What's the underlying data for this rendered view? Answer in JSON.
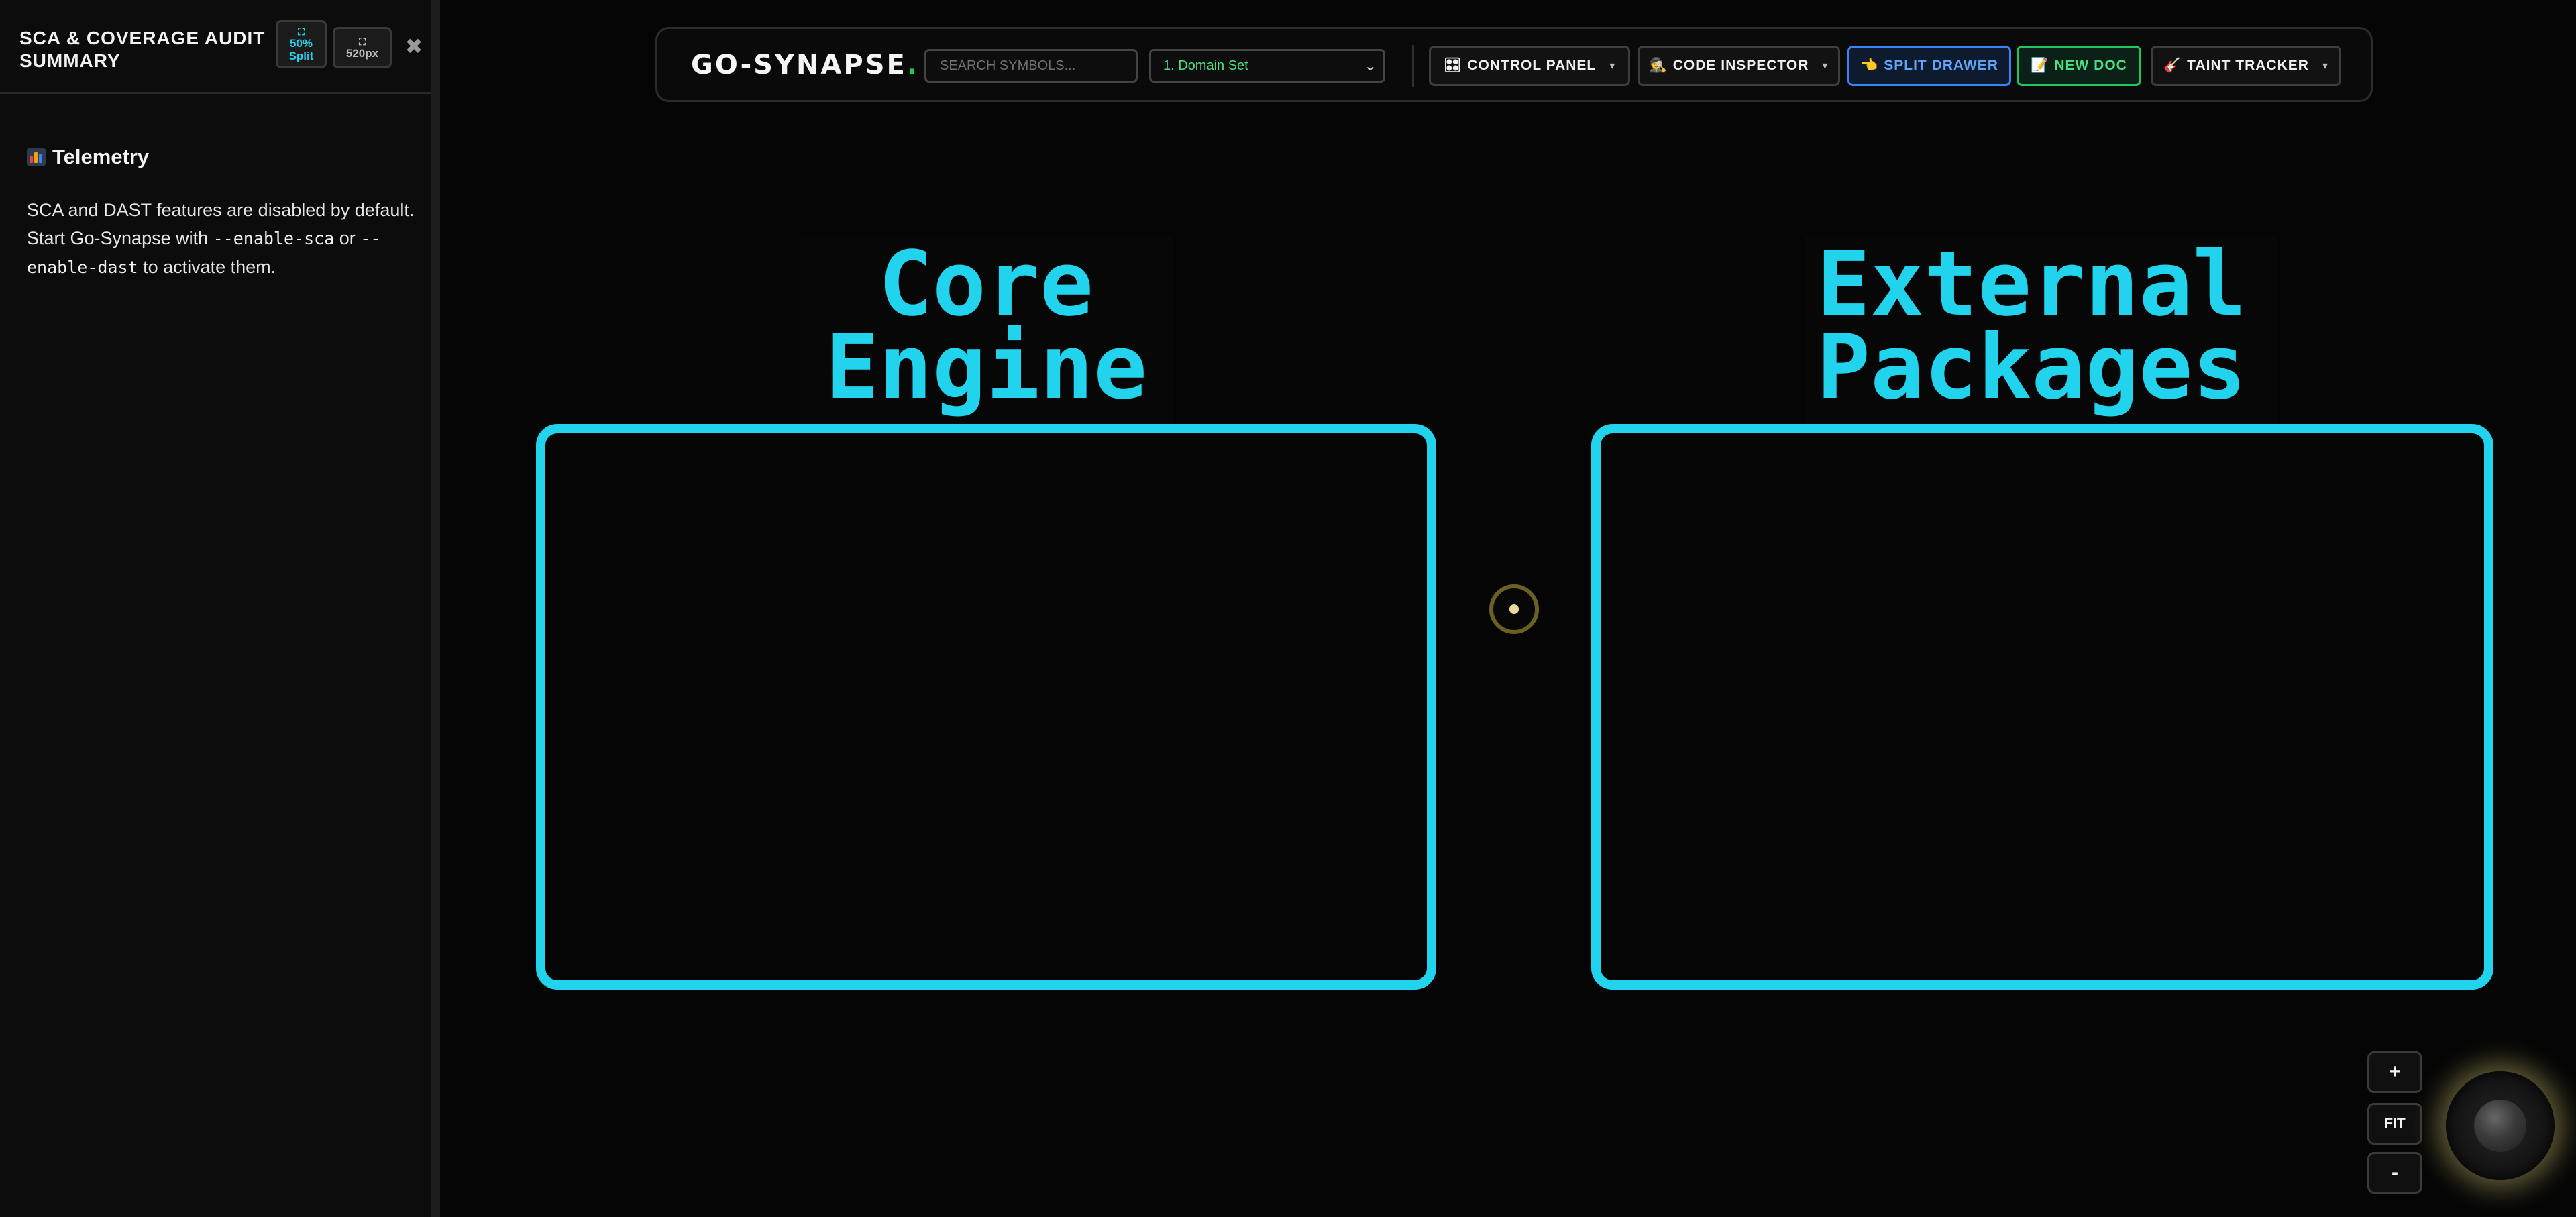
{
  "sidebar": {
    "title": "SCA & COVERAGE AUDIT SUMMARY",
    "split_button": {
      "icon": "expand-icon",
      "value": "50%",
      "label": "Split"
    },
    "width_button": {
      "icon": "expand-icon",
      "label": "520px"
    },
    "close_icon": "close-icon",
    "section_title": "Telemetry",
    "section_icon": "bar-chart-icon",
    "body": {
      "p1": "SCA and DAST features are disabled by default. Start Go-Synapse with ",
      "flag1": "--enable-sca",
      "p2": " or ",
      "flag2": "--enable-dast",
      "p3": " to activate them."
    }
  },
  "toolbar": {
    "logo_text": "GO-SYNAPSE",
    "logo_dot": ".",
    "search_placeholder": "SEARCH SYMBOLS...",
    "select_value": "1. Domain Set",
    "buttons": {
      "control_panel": {
        "icon": "grid-icon",
        "label": "CONTROL PANEL",
        "caret": "▾"
      },
      "code_inspector": {
        "icon": "detective-icon",
        "label": "CODE INSPECTOR",
        "caret": "▾"
      },
      "split_drawer": {
        "icon": "pointing-hand-icon",
        "label": "SPLIT DRAWER"
      },
      "new_doc": {
        "icon": "memo-icon",
        "label": "NEW DOC"
      },
      "taint_tracker": {
        "icon": "guitar-icon",
        "label": "TAINT TRACKER",
        "caret": "▾"
      }
    }
  },
  "canvas": {
    "groups": [
      {
        "label_line1": "Core",
        "label_line2": "Engine"
      },
      {
        "label_line1": "External",
        "label_line2": "Packages"
      }
    ],
    "accent_color": "#22d3ee"
  },
  "zoom": {
    "zoom_in": "+",
    "fit": "FIT",
    "zoom_out": "-"
  },
  "colors": {
    "background": "#050505",
    "accent": "#22d3ee",
    "green": "#22c55e",
    "blue": "#3b82f6"
  }
}
